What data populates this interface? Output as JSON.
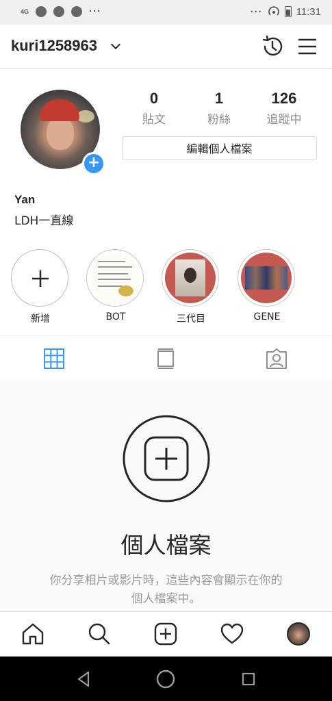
{
  "status_bar": {
    "network": "4G",
    "indicators": "···",
    "time": "11:31"
  },
  "header": {
    "username": "kuri1258963",
    "icons": [
      "chevron-down-icon",
      "history-icon",
      "menu-icon"
    ]
  },
  "profile": {
    "stats": [
      {
        "value": "0",
        "label": "貼文"
      },
      {
        "value": "1",
        "label": "粉絲"
      },
      {
        "value": "126",
        "label": "追蹤中"
      }
    ],
    "edit_button": "編輯個人檔案",
    "name": "Yan",
    "bio": "LDH一直線"
  },
  "highlights": [
    {
      "label": "新增"
    },
    {
      "label": "BOT"
    },
    {
      "label": "三代目"
    },
    {
      "label": "GENE"
    }
  ],
  "tabs": [
    "grid-icon",
    "feed-icon",
    "tagged-icon"
  ],
  "empty_state": {
    "title": "個人檔案",
    "description_line1": "你分享相片或影片時，這些內容會顯示在你的",
    "description_line2": "個人檔案中。"
  },
  "bottom_nav": [
    "home-icon",
    "search-icon",
    "new-post-icon",
    "activity-icon",
    "profile-avatar"
  ],
  "colors": {
    "accent": "#3897f0",
    "text": "#262626",
    "muted": "#8e8e8e",
    "border": "#dbdbdb"
  }
}
